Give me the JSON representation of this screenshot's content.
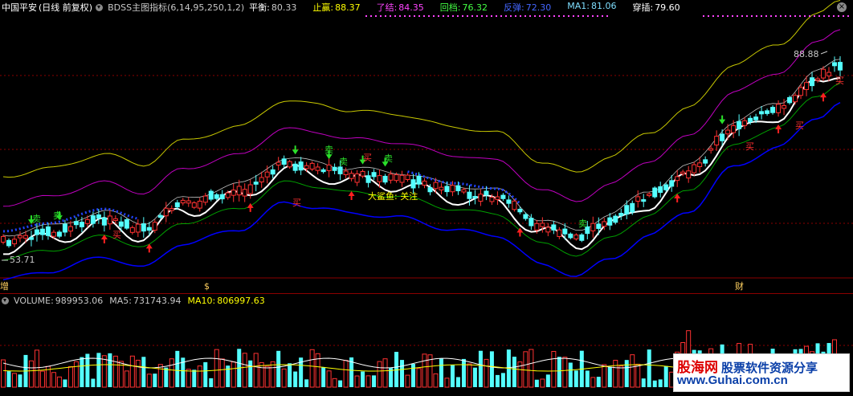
{
  "header": {
    "stock_name": "中国平安",
    "period": "(日线 前复权)",
    "indicator_name": "BDSS主图指标(6,14,95,250,1,2)",
    "fields": [
      {
        "label": "平衡:",
        "value": "80.33",
        "color": "#c8c8c8"
      },
      {
        "label": "止赢:",
        "value": "88.37",
        "color": "#ffff00"
      },
      {
        "label": "了结:",
        "value": "84.35",
        "color": "#ff44ff"
      },
      {
        "label": "回档:",
        "value": "76.32",
        "color": "#44ff44"
      },
      {
        "label": "反弹:",
        "value": "72.30",
        "color": "#4466ff"
      },
      {
        "label": "MA1:",
        "value": "81.06",
        "color": "#7fdfff"
      },
      {
        "label": "穿插:",
        "value": "79.60",
        "color": "#ffffff"
      }
    ]
  },
  "price_panel": {
    "high_label": "88.88",
    "low_label": "53.71",
    "markers": [
      "卖",
      "卖",
      "卖",
      "卖",
      "卖",
      "卖",
      "买",
      "买",
      "买",
      "买",
      "买",
      "买"
    ],
    "annotation": "大鲨鱼: 关注",
    "date_marks": [
      "增",
      "$",
      "财"
    ]
  },
  "volume_panel": {
    "title": "VOLUME:",
    "volume_value": "989953.06",
    "ma5_label": "MA5:",
    "ma5_value": "731743.94",
    "ma10_label": "MA10:",
    "ma10_value": "806997.63"
  },
  "watermark": {
    "cn_prefix": "股海网",
    "cn_suffix": "股票软件资源分享",
    "url": "www.Guhai.com.cn"
  },
  "colors": {
    "rise": "#ff3232",
    "fall": "#54ffff",
    "yellow_band": "#c8c800",
    "magenta_band": "#c000c0",
    "green_band": "#00a000",
    "blue_band": "#0000ff",
    "white_line": "#ffffff",
    "ma_line": "#ffff00"
  }
}
